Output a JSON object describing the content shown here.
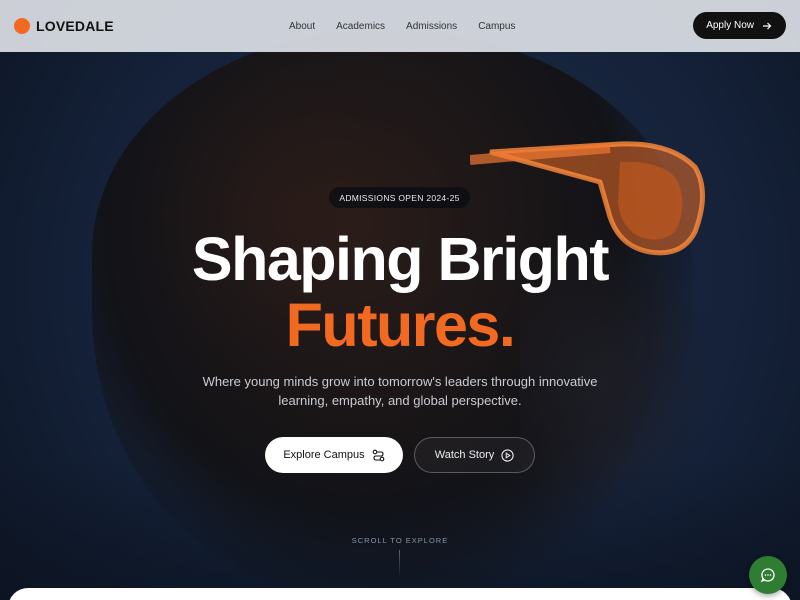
{
  "header": {
    "logo_text": "LOVEDALE",
    "nav": [
      "About",
      "Academics",
      "Admissions",
      "Campus"
    ],
    "apply_label": "Apply Now"
  },
  "hero": {
    "badge": "ADMISSIONS OPEN 2024-25",
    "title_line1": "Shaping Bright",
    "title_line2": "Futures.",
    "subtitle": "Where young minds grow into tomorrow's leaders through innovative learning, empathy, and global perspective.",
    "primary_button": "Explore Campus",
    "secondary_button": "Watch Story",
    "scroll_hint": "SCROLL TO EXPLORE"
  },
  "icons": {
    "logo": "orange-dot",
    "apply": "arrow-right-icon",
    "explore": "route-icon",
    "watch": "play-circle-icon",
    "chat": "chat-bubble-icon"
  },
  "colors": {
    "accent": "#f26a21",
    "header_bg": "#dadee4",
    "dark_button": "#111111",
    "chat_button": "#2e7d32"
  }
}
